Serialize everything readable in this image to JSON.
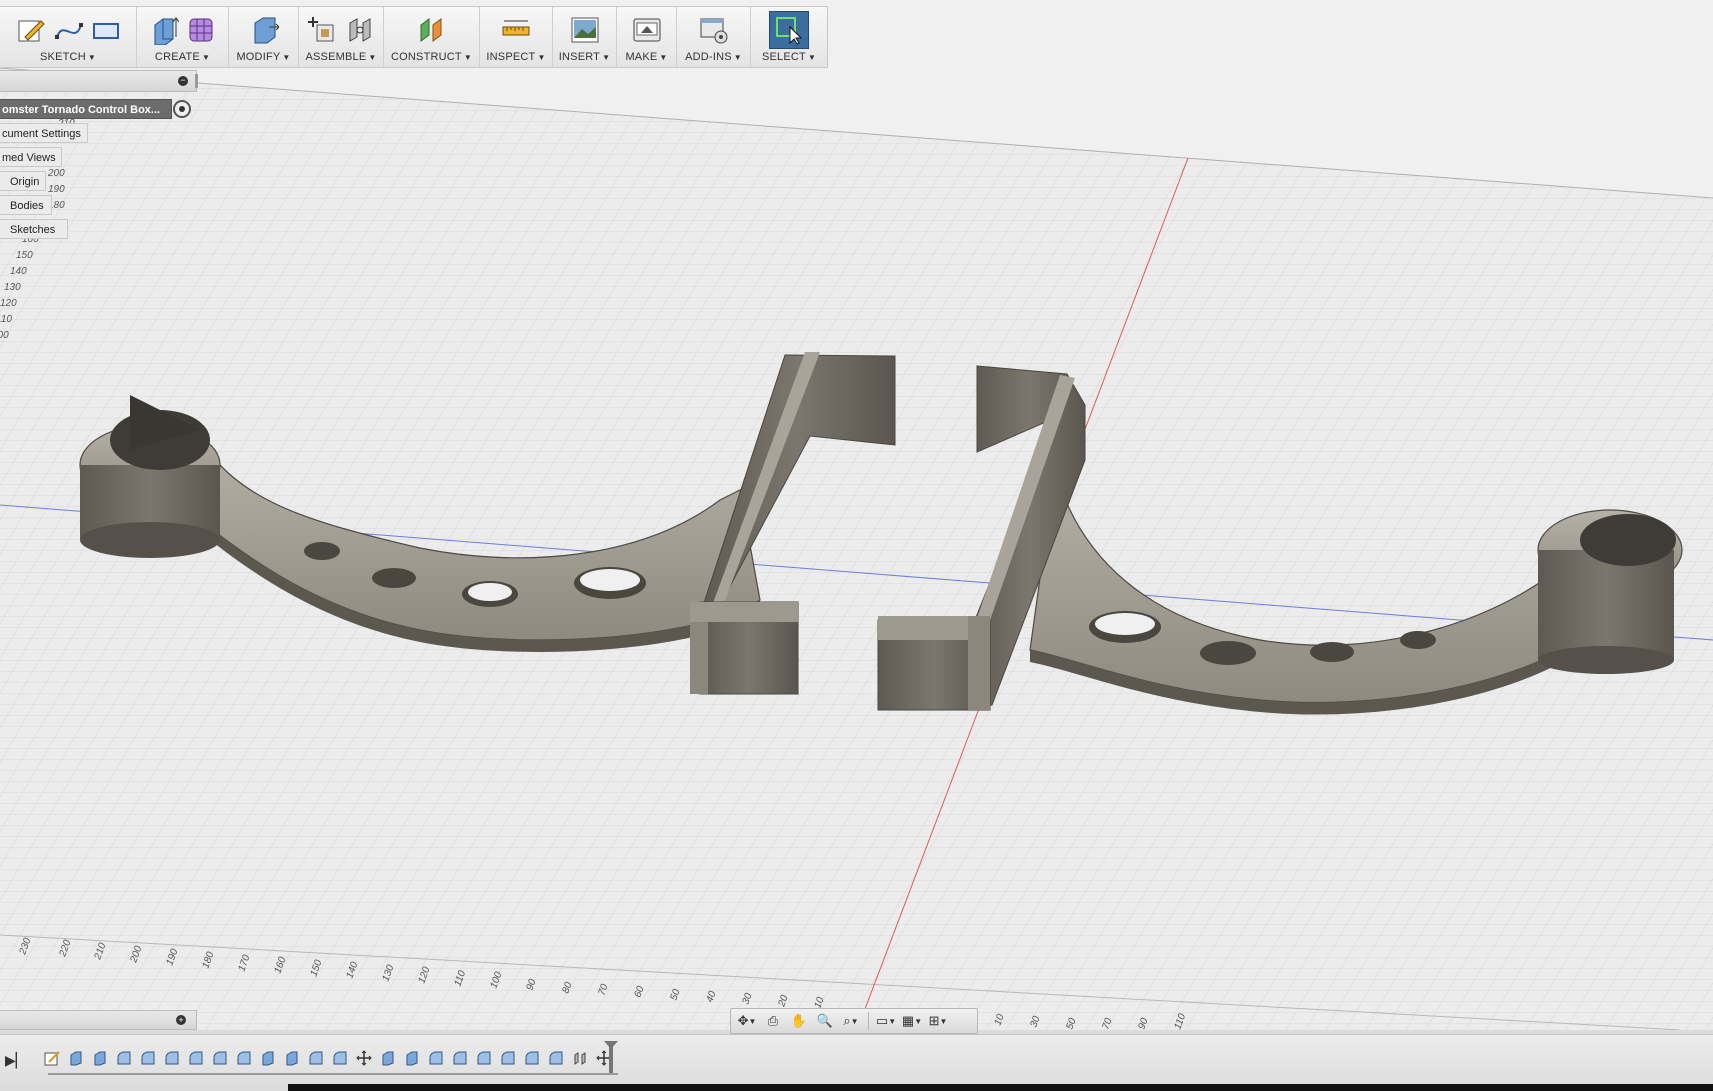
{
  "toolbar": {
    "groups": [
      {
        "label": "SKETCH",
        "icons": [
          "create-sketch-icon",
          "line-spline-icon",
          "rectangle-icon"
        ]
      },
      {
        "label": "CREATE",
        "icons": [
          "extrude-icon",
          "form-icon"
        ]
      },
      {
        "label": "MODIFY",
        "icons": [
          "press-pull-icon"
        ]
      },
      {
        "label": "ASSEMBLE",
        "icons": [
          "new-component-icon",
          "joint-icon"
        ]
      },
      {
        "label": "CONSTRUCT",
        "icons": [
          "offset-plane-icon"
        ]
      },
      {
        "label": "INSPECT",
        "icons": [
          "measure-icon"
        ]
      },
      {
        "label": "INSERT",
        "icons": [
          "insert-image-icon"
        ]
      },
      {
        "label": "MAKE",
        "icons": [
          "3d-print-icon"
        ]
      },
      {
        "label": "ADD-INS",
        "icons": [
          "scripts-addins-icon"
        ]
      },
      {
        "label": "SELECT",
        "icons": [
          "select-icon"
        ]
      }
    ]
  },
  "browser": {
    "root": "omster Tornado Control Box...",
    "items": [
      {
        "label": "cument Settings"
      },
      {
        "label": "med Views"
      },
      {
        "label": "Origin"
      },
      {
        "label": "Bodies"
      },
      {
        "label": "Sketches"
      }
    ]
  },
  "ruler_left": [
    "210",
    "200",
    "190",
    "180",
    "170",
    "160",
    "150",
    "140",
    "130",
    "120",
    "110",
    "100"
  ],
  "ruler_bottom": [
    "230",
    "220",
    "210",
    "200",
    "190",
    "180",
    "170",
    "160",
    "150",
    "140",
    "130",
    "120",
    "110",
    "100",
    "90",
    "80",
    "70",
    "60",
    "50",
    "40",
    "30",
    "20",
    "10"
  ],
  "ruler_right": [
    "10",
    "30",
    "50",
    "70",
    "90",
    "110"
  ],
  "navbar": {
    "tools": [
      "orbit-icon",
      "look-at-icon",
      "pan-icon",
      "zoom-icon",
      "fit-icon",
      "display-settings-icon",
      "grid-settings-icon",
      "viewports-icon"
    ]
  },
  "timeline": {
    "feature_count": 24
  },
  "colors": {
    "toolbar_bg": "#ececec",
    "viewport_bg": "#f0f0f0",
    "grid_line": "#d2d2d2",
    "axis_red": "#e05a5a",
    "axis_blue": "#6a7fe0",
    "body": "#6f6b63",
    "select_active": "#3b6e9e"
  }
}
